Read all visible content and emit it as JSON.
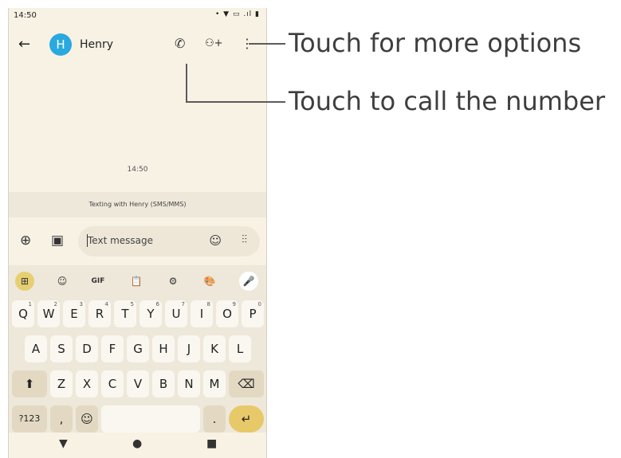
{
  "status": {
    "time": "14:50",
    "icons": "• ▼ ▭ .ıl ▮"
  },
  "contact": {
    "avatar_letter": "H",
    "name": "Henry"
  },
  "icons": {
    "back": "←",
    "call": "✆",
    "add_person": "⚇+",
    "more": "⋮"
  },
  "chat": {
    "timestamp": "14:50",
    "info": "Texting with Henry (SMS/MMS)"
  },
  "compose": {
    "add": "⊕",
    "gallery": "▣",
    "placeholder": "Text message",
    "emoji": "☺",
    "voice": "⫶⫶"
  },
  "keyboard_toolbar": {
    "grid": "⊞",
    "sticker": "☺",
    "gif": "GIF",
    "clipboard": "📋",
    "settings": "⚙",
    "palette": "🎨",
    "mic": "🎤"
  },
  "row1": [
    {
      "k": "Q",
      "s": "1"
    },
    {
      "k": "W",
      "s": "2"
    },
    {
      "k": "E",
      "s": "3"
    },
    {
      "k": "R",
      "s": "4"
    },
    {
      "k": "T",
      "s": "5"
    },
    {
      "k": "Y",
      "s": "6"
    },
    {
      "k": "U",
      "s": "7"
    },
    {
      "k": "I",
      "s": "8"
    },
    {
      "k": "O",
      "s": "9"
    },
    {
      "k": "P",
      "s": "0"
    }
  ],
  "row2": [
    "A",
    "S",
    "D",
    "F",
    "G",
    "H",
    "J",
    "K",
    "L"
  ],
  "row3": {
    "shift": "⬆",
    "letters": [
      "Z",
      "X",
      "C",
      "V",
      "B",
      "N",
      "M"
    ],
    "backspace": "⌫"
  },
  "row4": {
    "sym": "?123",
    "comma": ",",
    "emoji": "☺",
    "period": ".",
    "enter": "↵"
  },
  "navbar": {
    "back": "▼",
    "home": "●",
    "recents": "■"
  },
  "callouts": {
    "more_options": "Touch for more options",
    "call_number": "Touch to call the number"
  }
}
